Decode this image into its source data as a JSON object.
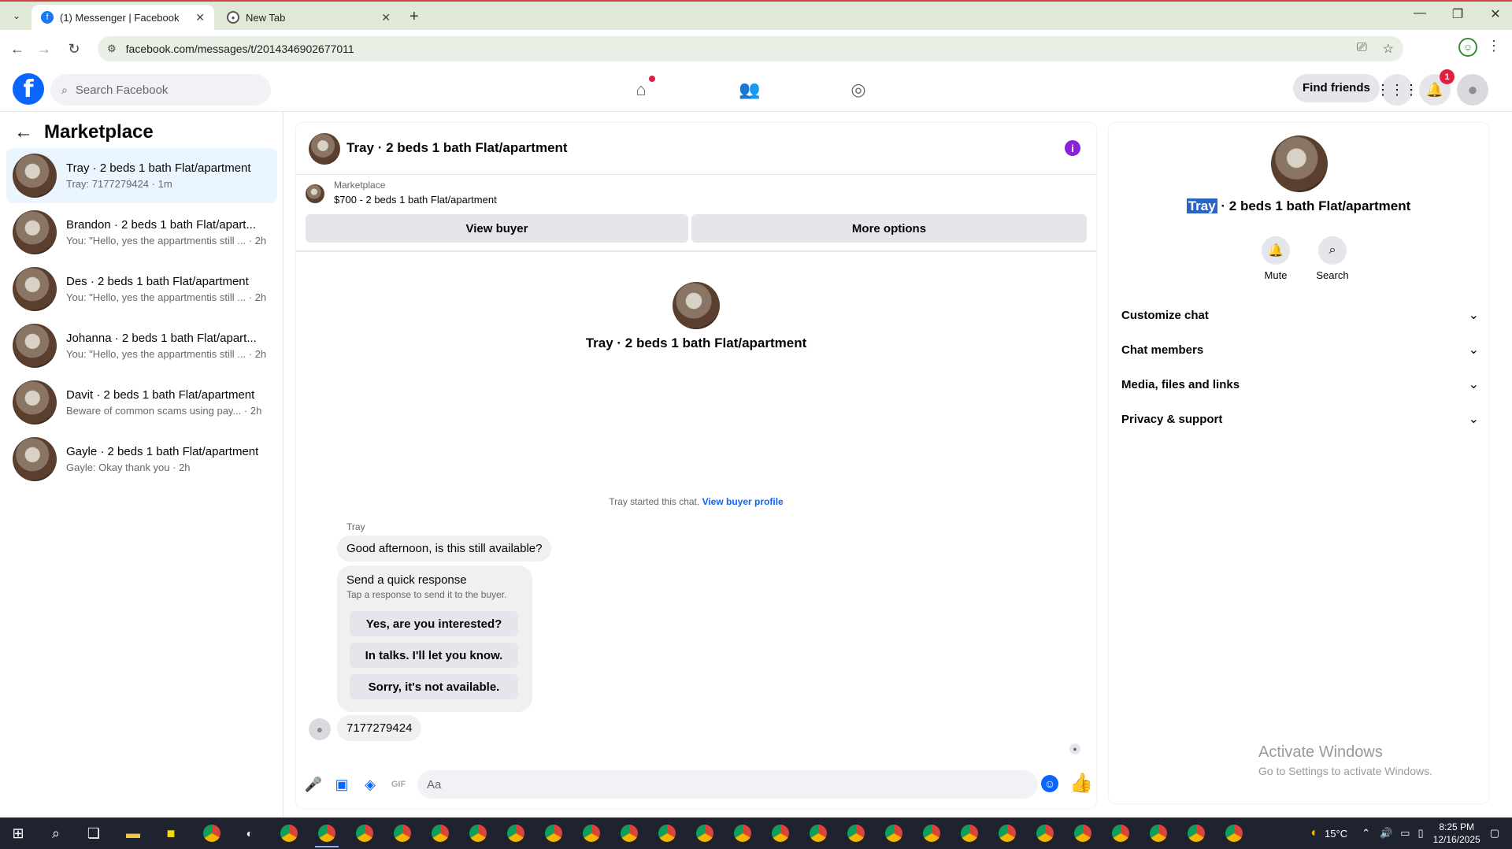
{
  "browser": {
    "tabs": [
      {
        "title": "(1) Messenger | Facebook",
        "icon": "facebook-icon"
      },
      {
        "title": "New Tab",
        "icon": "chrome-icon"
      }
    ],
    "url": "facebook.com/messages/t/2014346902677011"
  },
  "fb": {
    "search_placeholder": "Search Facebook",
    "find_friends": "Find friends",
    "notification_count": "1",
    "brand_color": "#0866ff"
  },
  "sidebar": {
    "title": "Marketplace",
    "conversations": [
      {
        "title": "Tray · 2 beds 1 bath Flat/apartment",
        "snippet": "Tray: 7177279424 · 1m",
        "active": true
      },
      {
        "title": "Brandon · 2 beds 1 bath Flat/apart...",
        "snippet": "You: \"Hello, yes the appartmentis still ... · 2h"
      },
      {
        "title": "Des · 2 beds 1 bath Flat/apartment",
        "snippet": "You: \"Hello, yes the appartmentis still ... · 2h"
      },
      {
        "title": "Johanna · 2 beds 1 bath Flat/apart...",
        "snippet": "You: \"Hello, yes the appartmentis still ... · 2h"
      },
      {
        "title": "Davit · 2 beds 1 bath Flat/apartment",
        "snippet": "Beware of common scams using pay... · 2h"
      },
      {
        "title": "Gayle · 2 beds 1 bath Flat/apartment",
        "snippet": "Gayle: Okay thank you · 2h"
      }
    ]
  },
  "chat": {
    "title": "Tray · 2 beds 1 bath Flat/apartment",
    "listing_source": "Marketplace",
    "listing_price": "$700 - 2 beds 1 bath Flat/apartment",
    "view_buyer": "View buyer",
    "more_options": "More options",
    "hero_title": "Tray · 2 beds 1 bath Flat/apartment",
    "started_text": "Tray started this chat.",
    "view_buyer_profile": "View buyer profile",
    "sender": "Tray",
    "message1": "Good afternoon, is this still available?",
    "quick_title": "Send a quick response",
    "quick_subtitle": "Tap a response to send it to the buyer.",
    "quick_responses": [
      "Yes, are you interested?",
      "In talks. I'll let you know.",
      "Sorry, it's not available."
    ],
    "message2": "7177279424",
    "composer_placeholder": "Aa"
  },
  "details": {
    "name_highlight": "Tray",
    "name_rest": " · 2 beds 1 bath Flat/apartment",
    "actions": [
      "Mute",
      "Search"
    ],
    "sections": [
      "Customize chat",
      "Chat members",
      "Media, files and links",
      "Privacy & support"
    ]
  },
  "watermark": {
    "line1": "Activate Windows",
    "line2": "Go to Settings to activate Windows."
  },
  "taskbar": {
    "temperature": "15°C",
    "time": "8:25 PM",
    "date": "12/16/2025"
  }
}
